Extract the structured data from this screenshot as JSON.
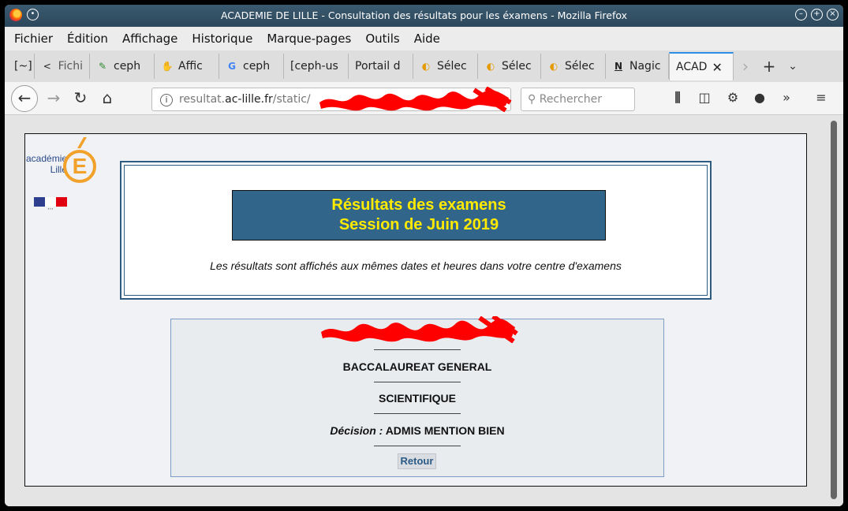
{
  "window": {
    "title": "ACADEMIE DE LILLE - Consultation des résultats pour les éxamens - Mozilla Firefox"
  },
  "menu": [
    "Fichier",
    "Édition",
    "Affichage",
    "Historique",
    "Marque-pages",
    "Outils",
    "Aide"
  ],
  "tabs": [
    {
      "label": "[~]",
      "icon": "terminal-icon"
    },
    {
      "label": "Fichi",
      "icon": "back-arrow-icon"
    },
    {
      "label": "ceph",
      "icon": "ceph-icon"
    },
    {
      "label": "Affic",
      "icon": "hand-icon"
    },
    {
      "label": "ceph",
      "icon": "google-icon"
    },
    {
      "label": "[ceph-us",
      "icon": ""
    },
    {
      "label": "Portail d",
      "icon": ""
    },
    {
      "label": "Sélec",
      "icon": "fish-icon"
    },
    {
      "label": "Sélec",
      "icon": "fish-icon"
    },
    {
      "label": "Sélec",
      "icon": "fish-icon"
    },
    {
      "label": "Nagic",
      "icon": "nagios-icon"
    },
    {
      "label": "ACAD",
      "icon": "",
      "active": true
    }
  ],
  "nav": {
    "url_prefix": "resultat.",
    "url_host": "ac-lille.fr",
    "url_path": "/static/",
    "search_placeholder": "Rechercher"
  },
  "logo": {
    "line1": "académie",
    "line2": "Lille",
    "letter": "E"
  },
  "header": {
    "title_line1": "Résultats des examens",
    "title_line2": "Session de Juin 2019",
    "subtitle": "Les résultats sont affichés aux mêmes dates et heures dans votre centre d'examens"
  },
  "result": {
    "exam": "BACCALAUREAT GENERAL",
    "series": "SCIENTIFIQUE",
    "decision_label": "Décision :",
    "decision_value": "ADMIS MENTION BIEN",
    "back_button": "Retour"
  },
  "colors": {
    "banner_bg": "#32658a",
    "banner_text": "#ffea00",
    "accent_orange": "#f2a22b",
    "redaction": "#ff0000"
  }
}
